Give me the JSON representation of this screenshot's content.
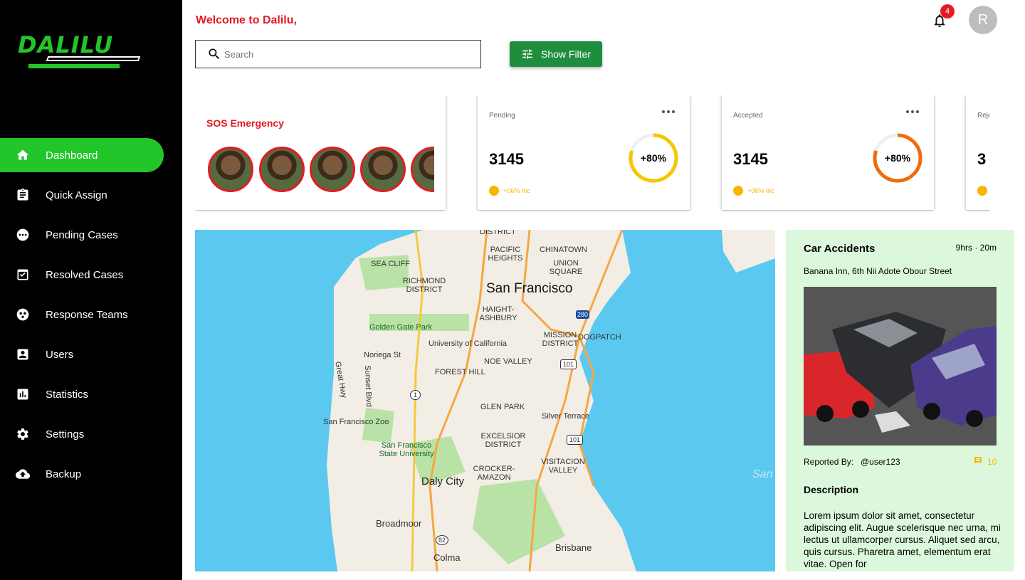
{
  "app": {
    "brand": "DALILU",
    "welcome": "Welcome to Dalilu,",
    "avatar_initial": "R",
    "notification_count": "4"
  },
  "sidebar": {
    "items": [
      {
        "label": "Dashboard",
        "icon": "home-icon",
        "active": true
      },
      {
        "label": "Quick Assign",
        "icon": "clipboard-icon"
      },
      {
        "label": "Pending Cases",
        "icon": "more-circle-icon"
      },
      {
        "label": "Resolved Cases",
        "icon": "check-box-icon"
      },
      {
        "label": "Response Teams",
        "icon": "team-icon"
      },
      {
        "label": "Users",
        "icon": "user-box-icon"
      },
      {
        "label": "Statistics",
        "icon": "bar-chart-icon"
      },
      {
        "label": "Settings",
        "icon": "gear-icon"
      },
      {
        "label": "Backup",
        "icon": "cloud-upload-icon"
      }
    ]
  },
  "search": {
    "placeholder": "Search",
    "value": ""
  },
  "toolbar": {
    "filter_label": "Show Filter"
  },
  "sos": {
    "title": "SOS Emergency"
  },
  "stats": [
    {
      "label": "Pending",
      "value": "3145",
      "percent_label": "+80%",
      "percent": 0.8,
      "trend": "+06% Inc",
      "ring_color": "#f7c600"
    },
    {
      "label": "Accepted",
      "value": "3145",
      "percent_label": "+80%",
      "percent": 0.8,
      "trend": "+06% Inc",
      "ring_color": "#f26a10"
    },
    {
      "label": "Reje",
      "value": "3",
      "percent_label": "",
      "percent": 0.8,
      "trend": "",
      "ring_color": "#f26a10"
    }
  ],
  "map": {
    "labels": {
      "district": "DISTRICT",
      "pacific_heights": "PACIFIC HEIGHTS",
      "chinatown": "CHINATOWN",
      "union_square": "UNION SQUARE",
      "sea_cliff": "SEA CLIFF",
      "richmond": "RICHMOND DISTRICT",
      "san_francisco": "San Francisco",
      "haight": "HAIGHT-ASHBURY",
      "golden_gate_park": "Golden Gate Park",
      "mission": "MISSION DISTRICT",
      "dogpatch": "DOGPATCH",
      "ucsf": "University of California",
      "noriega": "Noriega St",
      "forest_hill": "FOREST HILL",
      "noe_valley": "NOE VALLEY",
      "great_hwy": "Great Hwy",
      "sunset_blvd": "Sunset Blvd",
      "glen_park": "GLEN PARK",
      "silver_terrace": "Silver Terrace",
      "sf_zoo": "San Francisco Zoo",
      "excelsior": "EXCELSIOR DISTRICT",
      "sfsu": "San Francisco State University",
      "visitacion": "VISITACION VALLEY",
      "crocker": "CROCKER-AMAZON",
      "daly_city": "Daly City",
      "broadmoor": "Broadmoor",
      "brisbane": "Brisbane",
      "colma": "Colma",
      "san_bay": "San",
      "shield_280": "280",
      "shield_101a": "101",
      "shield_101b": "101",
      "shield_1": "1",
      "shield_82": "82"
    }
  },
  "incident": {
    "title": "Car Accidents",
    "time": "9hrs · 20m",
    "address": "Banana Inn, 6th Nii Adote Obour Street",
    "reported_label": "Reported By:",
    "reported_user": "@user123",
    "comments": "10",
    "description_title": "Description",
    "description": "Lorem ipsum dolor sit amet, consectetur adipiscing elit. Augue scelerisque nec urna, mi lectus ut ullamcorper cursus. Aliquet sed arcu, quis cursus. Pharetra amet, elementum erat vitae. Open for"
  },
  "colors": {
    "brand_green": "#22c52a",
    "alert_red": "#e31b23",
    "button_green": "#1e8e3e",
    "panel_bg": "#dcf8dc"
  }
}
